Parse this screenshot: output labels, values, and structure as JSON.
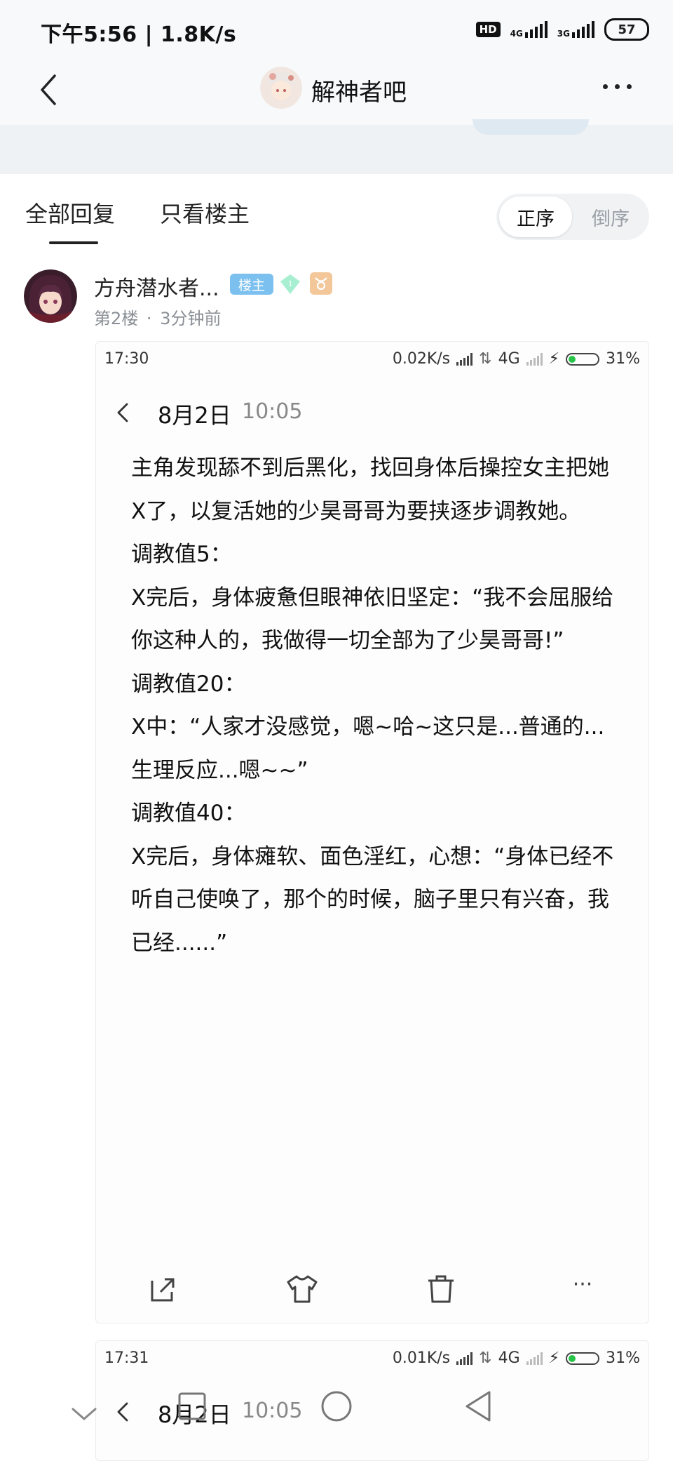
{
  "status_bar": {
    "time_speed": "下午5:56 | 1.8K/s",
    "hd": "HD",
    "net1": "4G",
    "net2": "3G",
    "battery": "57"
  },
  "header": {
    "title": "解神者吧",
    "back_icon": "chevron-left-icon",
    "more_icon": "more-dots-icon"
  },
  "tabs": {
    "all": "全部回复",
    "op_only": "只看楼主",
    "sort_asc": "正序",
    "sort_desc": "倒序"
  },
  "post": {
    "username": "方舟潜水者...",
    "op_badge": "楼主",
    "level_badge": "1",
    "floor": "第2楼",
    "separator": "·",
    "time_ago": "3分钟前",
    "colors": {
      "op_badge": "#7cc0ef",
      "zodiac": "#f3c79a"
    }
  },
  "screenshot1": {
    "time": "17:30",
    "speed": "0.02K/s",
    "net": "4G",
    "battery": "31%",
    "date": "8月2日",
    "clock": "10:05",
    "lines": [
      "主角发现舔不到后黑化，找回身体后操控女主把她X了，以复活她的少昊哥哥为要挟逐步调教她。",
      "调教值5：",
      "X完后，身体疲惫但眼神依旧坚定：“我不会屈服给你这种人的，我做得一切全部为了少昊哥哥!”",
      "调教值20：",
      "X中：“人家才没感觉，嗯~哈~这只是...普通的...生理反应...嗯~~”",
      "调教值40：",
      "X完后，身体瘫软、面色淫红，心想：“身体已经不听自己使唤了，那个的时候，脑子里只有兴奋，我已经......”"
    ],
    "actions": [
      "share-icon",
      "tshirt-icon",
      "trash-icon",
      "more-icon"
    ],
    "more_label": "···"
  },
  "screenshot2": {
    "time": "17:31",
    "speed": "0.01K/s",
    "net": "4G",
    "battery": "31%",
    "date": "8月2日",
    "clock": "10:05"
  },
  "system_nav": [
    "chevron-down-icon",
    "square-icon",
    "circle-icon",
    "triangle-back-icon"
  ]
}
